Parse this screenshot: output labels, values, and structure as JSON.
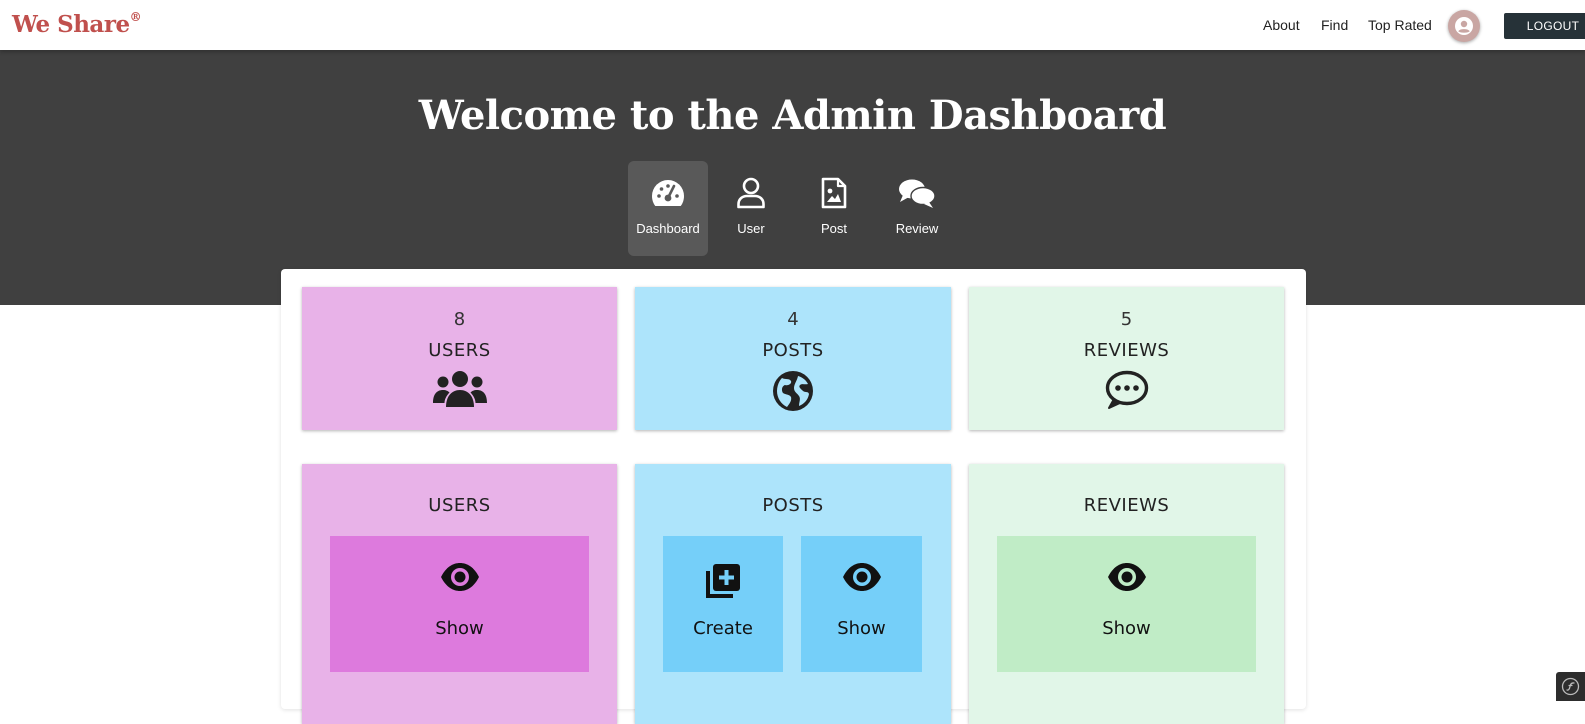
{
  "brand": {
    "name": "We Share",
    "mark": "®"
  },
  "nav": {
    "about": "About",
    "find": "Find",
    "top_rated": "Top Rated",
    "logout": "LOGOUT"
  },
  "hero": {
    "title": "Welcome to the Admin Dashboard"
  },
  "tabs": [
    {
      "label": "Dashboard",
      "icon": "tachometer-icon",
      "active": true
    },
    {
      "label": "User",
      "icon": "user-icon",
      "active": false
    },
    {
      "label": "Post",
      "icon": "file-image-icon",
      "active": false
    },
    {
      "label": "Review",
      "icon": "comments-icon",
      "active": false
    }
  ],
  "stats": [
    {
      "count": "8",
      "label": "USERS",
      "icon": "users-icon",
      "color": "#e8b2e8"
    },
    {
      "count": "4",
      "label": "POSTS",
      "icon": "globe-icon",
      "color": "#ade4fb"
    },
    {
      "count": "5",
      "label": "REVIEWS",
      "icon": "comment-dots-icon",
      "color": "#e1f6e8"
    }
  ],
  "sections": [
    {
      "title": "USERS",
      "actions": [
        {
          "label": "Show",
          "icon": "eye-icon"
        }
      ]
    },
    {
      "title": "POSTS",
      "actions": [
        {
          "label": "Create",
          "icon": "add-box-icon"
        },
        {
          "label": "Show",
          "icon": "eye-icon"
        }
      ]
    },
    {
      "title": "REVIEWS",
      "actions": [
        {
          "label": "Show",
          "icon": "eye-icon"
        }
      ]
    }
  ],
  "colors": {
    "brand": "#c0504d",
    "hero_bg": "#404040",
    "tab_active": "#595959",
    "logout_bg": "#263238",
    "pink_card": "#e8b2e8",
    "pink_button": "#dd7add",
    "blue_card": "#ade4fb",
    "blue_button": "#75cff9",
    "green_card": "#e1f6e8",
    "green_button": "#c0ecc6"
  }
}
